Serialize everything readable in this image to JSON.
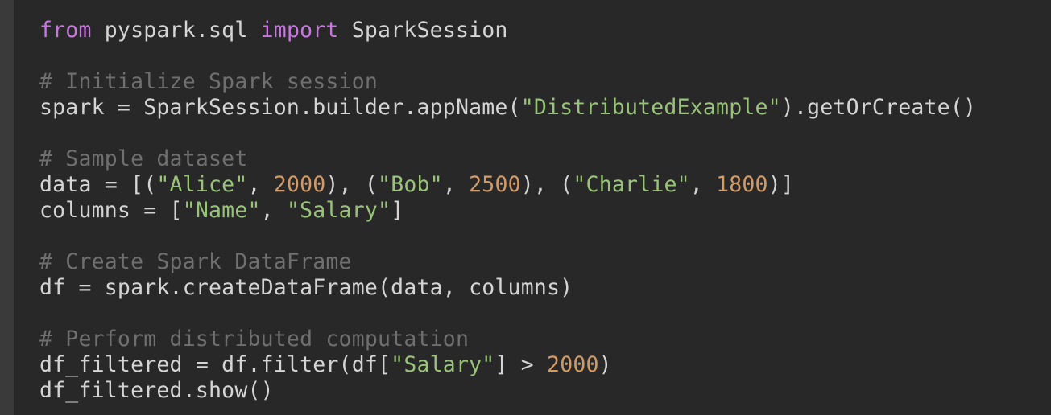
{
  "editor": {
    "language": "python",
    "colors": {
      "background": "#282828",
      "gutter": "#3a3a3a",
      "keyword": "#c678dd",
      "comment": "#6f6f6f",
      "string": "#98c379",
      "number": "#d19a66",
      "text": "#d4d4d4"
    },
    "lines": [
      [
        {
          "t": "kw",
          "v": "from"
        },
        {
          "t": "pl",
          "v": " pyspark.sql "
        },
        {
          "t": "kw",
          "v": "import"
        },
        {
          "t": "pl",
          "v": " SparkSession"
        }
      ],
      [],
      [
        {
          "t": "cm",
          "v": "# Initialize Spark session"
        }
      ],
      [
        {
          "t": "pl",
          "v": "spark = SparkSession.builder.appName("
        },
        {
          "t": "str",
          "v": "\"DistributedExample\""
        },
        {
          "t": "pl",
          "v": ").getOrCreate()"
        }
      ],
      [],
      [
        {
          "t": "cm",
          "v": "# Sample dataset"
        }
      ],
      [
        {
          "t": "pl",
          "v": "data = [("
        },
        {
          "t": "str",
          "v": "\"Alice\""
        },
        {
          "t": "pl",
          "v": ", "
        },
        {
          "t": "num",
          "v": "2000"
        },
        {
          "t": "pl",
          "v": "), ("
        },
        {
          "t": "str",
          "v": "\"Bob\""
        },
        {
          "t": "pl",
          "v": ", "
        },
        {
          "t": "num",
          "v": "2500"
        },
        {
          "t": "pl",
          "v": "), ("
        },
        {
          "t": "str",
          "v": "\"Charlie\""
        },
        {
          "t": "pl",
          "v": ", "
        },
        {
          "t": "num",
          "v": "1800"
        },
        {
          "t": "pl",
          "v": ")]"
        }
      ],
      [
        {
          "t": "pl",
          "v": "columns = ["
        },
        {
          "t": "str",
          "v": "\"Name\""
        },
        {
          "t": "pl",
          "v": ", "
        },
        {
          "t": "str",
          "v": "\"Salary\""
        },
        {
          "t": "pl",
          "v": "]"
        }
      ],
      [],
      [
        {
          "t": "cm",
          "v": "# Create Spark DataFrame"
        }
      ],
      [
        {
          "t": "pl",
          "v": "df = spark.createDataFrame(data, columns)"
        }
      ],
      [],
      [
        {
          "t": "cm",
          "v": "# Perform distributed computation"
        }
      ],
      [
        {
          "t": "pl",
          "v": "df_filtered = df.filter(df["
        },
        {
          "t": "str",
          "v": "\"Salary\""
        },
        {
          "t": "pl",
          "v": "] > "
        },
        {
          "t": "num",
          "v": "2000"
        },
        {
          "t": "pl",
          "v": ")"
        }
      ],
      [
        {
          "t": "pl",
          "v": "df_filtered.show()"
        }
      ]
    ]
  }
}
